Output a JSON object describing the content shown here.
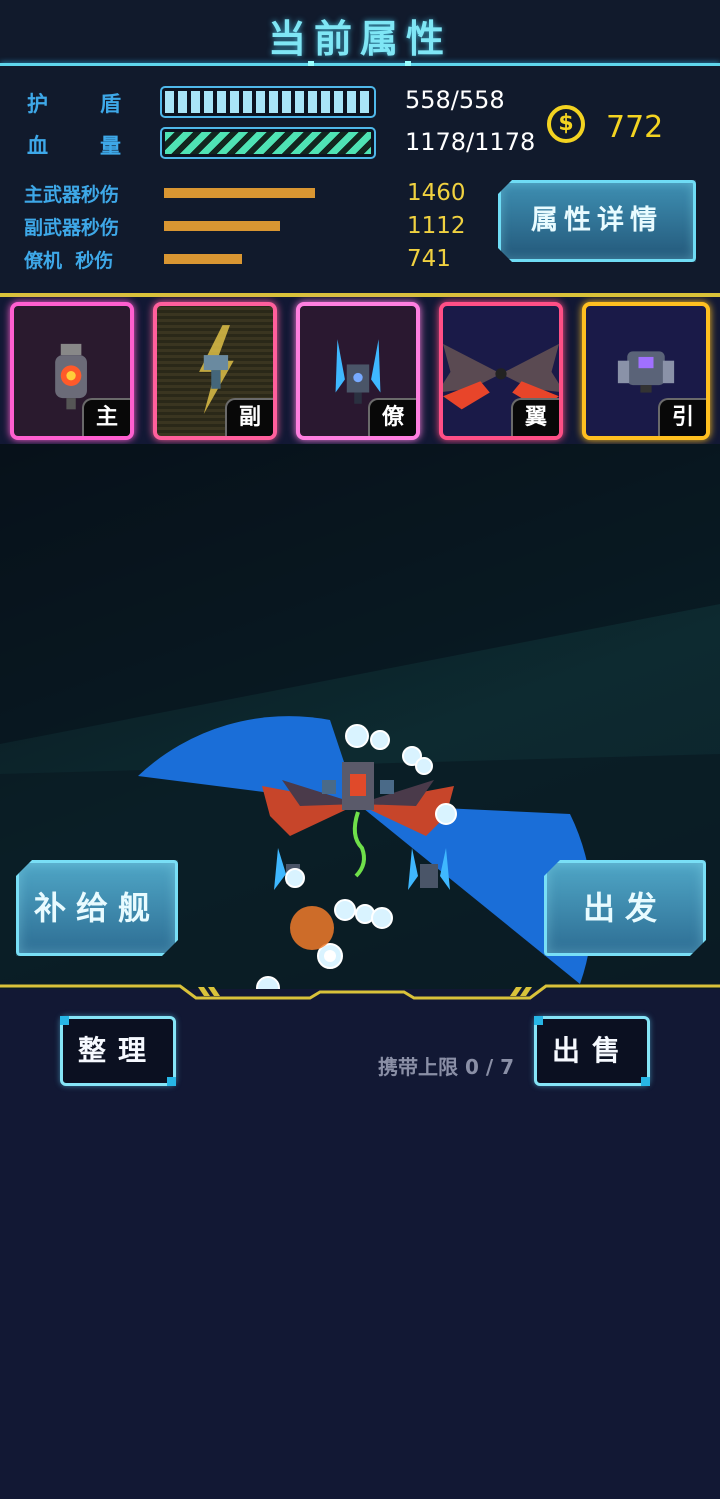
{
  "header": {
    "title": "当前属性"
  },
  "stats": {
    "shield": {
      "label": "护盾",
      "value": "558/558"
    },
    "hp": {
      "label": "血量",
      "value": "1178/1178"
    },
    "dps": [
      {
        "label": "主武器秒伤",
        "value": "1460",
        "fill": 0.72
      },
      {
        "label": "副武器秒伤",
        "value": "1112",
        "fill": 0.55
      },
      {
        "label": "僚机  秒伤",
        "value": "741",
        "fill": 0.37
      }
    ],
    "coins": {
      "value": "772",
      "icon": "coin-icon"
    },
    "detail_button": "属性详情"
  },
  "equipment": [
    {
      "tag": "主",
      "color": "#ff5fd0"
    },
    {
      "tag": "副",
      "color": "#ff5f9c"
    },
    {
      "tag": "僚",
      "color": "#ff7fe0"
    },
    {
      "tag": "翼",
      "color": "#ff4f86"
    },
    {
      "tag": "引",
      "color": "#ffbf20"
    }
  ],
  "actions": {
    "supply": "补给舰",
    "depart": "出发",
    "sort": "整理",
    "sell": "出售",
    "carry_limit": "携带上限 0 / 7"
  },
  "colors": {
    "accent": "#5fd6ec",
    "gold": "#f3d321",
    "bg": "#121834"
  }
}
